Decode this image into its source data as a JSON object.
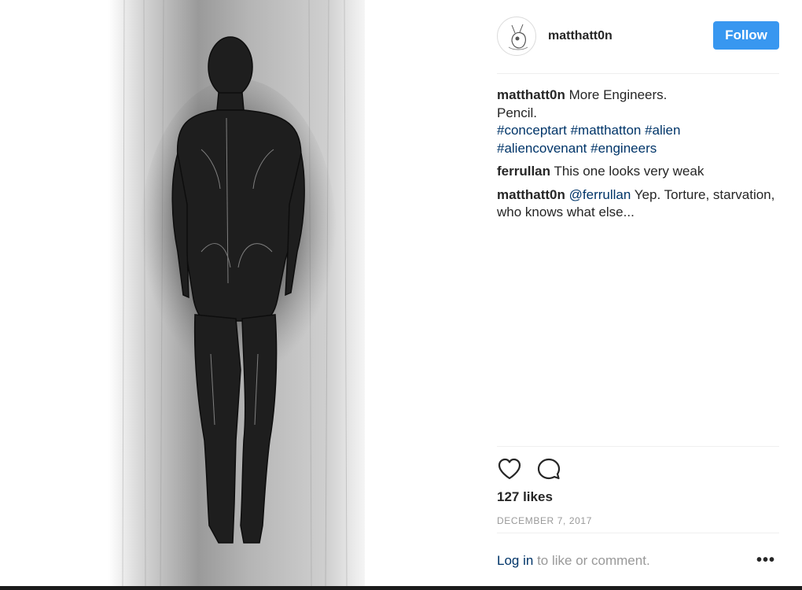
{
  "post": {
    "username": "matthatt0n",
    "follow_label": "Follow",
    "caption": {
      "user": "matthatt0n",
      "text_line1": "More Engineers.",
      "text_line2": "Pencil.",
      "hashtags_line1": [
        "#conceptart",
        "#matthatton",
        "#alien"
      ],
      "hashtags_line2": [
        "#aliencovenant",
        "#engineers"
      ]
    },
    "comments": [
      {
        "user": "ferrullan",
        "text": "This one looks very weak"
      },
      {
        "user": "matthatt0n",
        "mention": "@ferrullan",
        "text": "Yep. Torture, starvation, who knows what else..."
      }
    ],
    "likes": "127 likes",
    "date": "DECEMBER 7, 2017",
    "login_link": "Log in",
    "login_suffix": "to like or comment.",
    "more_label": "•••"
  },
  "icons": {
    "like": "heart-icon",
    "comment": "comment-bubble-icon",
    "more": "more-options-icon"
  },
  "colors": {
    "follow_button": "#3897f0",
    "link": "#003569",
    "muted": "#999999",
    "text": "#262626"
  }
}
